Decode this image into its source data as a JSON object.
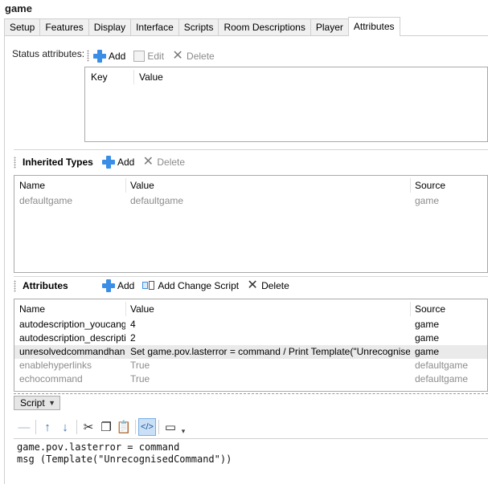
{
  "window": {
    "title": "game"
  },
  "tabs": [
    {
      "label": "Setup",
      "active": false
    },
    {
      "label": "Features",
      "active": false
    },
    {
      "label": "Display",
      "active": false
    },
    {
      "label": "Interface",
      "active": false
    },
    {
      "label": "Scripts",
      "active": false
    },
    {
      "label": "Room Descriptions",
      "active": false
    },
    {
      "label": "Player",
      "active": false
    },
    {
      "label": "Attributes",
      "active": true
    }
  ],
  "status_attributes": {
    "label": "Status attributes:",
    "toolbar": {
      "add": "Add",
      "edit": "Edit",
      "delete": "Delete"
    },
    "columns": [
      "Key",
      "Value"
    ]
  },
  "inherited_types": {
    "title": "Inherited Types",
    "toolbar": {
      "add": "Add",
      "delete": "Delete"
    },
    "columns": [
      "Name",
      "Value",
      "Source"
    ],
    "rows": [
      {
        "name": "defaultgame",
        "value": "defaultgame",
        "source": "game"
      }
    ]
  },
  "attributes": {
    "title": "Attributes",
    "toolbar": {
      "add": "Add",
      "add_change_script": "Add Change Script",
      "delete": "Delete"
    },
    "columns": [
      "Name",
      "Value",
      "Source"
    ],
    "rows": [
      {
        "name": "autodescription_youcango",
        "value": "4",
        "source": "game"
      },
      {
        "name": "autodescription_description",
        "value": "2",
        "source": "game"
      },
      {
        "name": "unresolvedcommandhan...",
        "value": "Set game.pov.lasterror = command / Print Template(\"UnrecognisedCo...",
        "source": "game"
      },
      {
        "name": "enablehyperlinks",
        "value": "True",
        "source": "defaultgame"
      },
      {
        "name": "echocommand",
        "value": "True",
        "source": "defaultgame"
      }
    ]
  },
  "script_editor": {
    "dropdown_value": "Script",
    "code_lines": [
      "game.pov.lasterror = command",
      "msg (Template(\"UnrecognisedCommand\"))"
    ]
  },
  "colors": {
    "accent": "#3a8ee6",
    "selected_row": "#eaeaea",
    "dim_text": "#8c8c8c"
  }
}
